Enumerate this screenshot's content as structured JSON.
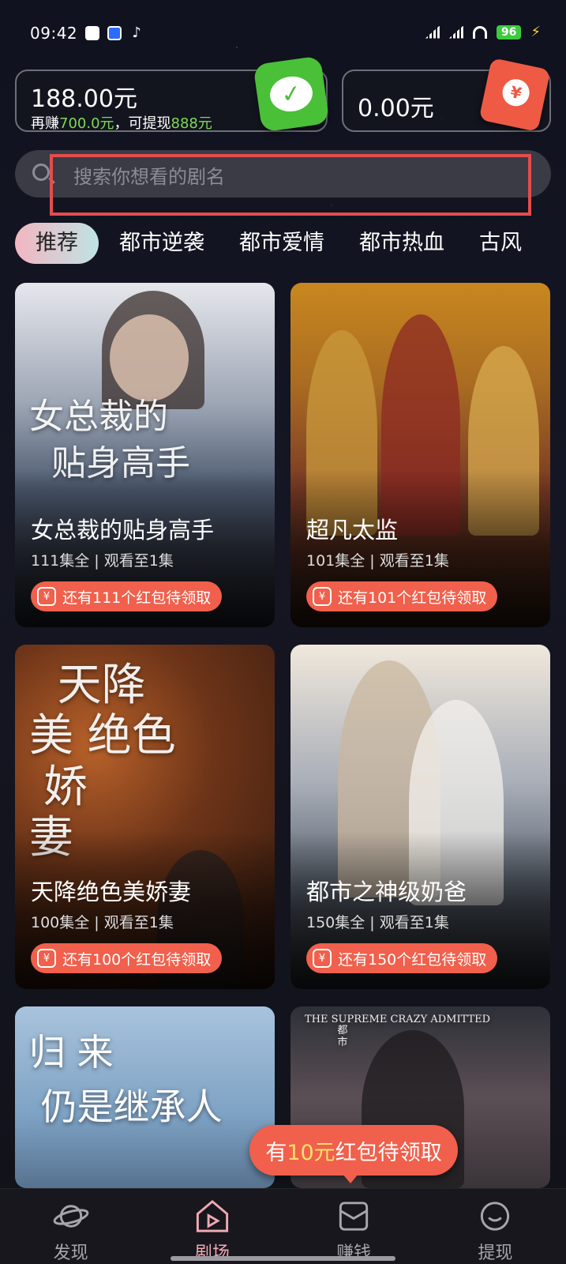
{
  "status_bar": {
    "time": "09:42",
    "battery": "96"
  },
  "wallet": {
    "amount": "188.00元",
    "sub_prefix": "再赚",
    "sub_earn": "700.0元",
    "sub_mid": "，可提现",
    "sub_withdraw": "888元",
    "badge_icon": "wechat-pay-icon"
  },
  "red_wallet": {
    "amount": "0.00元",
    "badge_icon": "red-envelope-icon",
    "coin_symbol": "¥"
  },
  "search": {
    "placeholder": "搜索你想看的剧名"
  },
  "tabs": [
    {
      "label": "推荐",
      "active": true
    },
    {
      "label": "都市逆袭",
      "active": false
    },
    {
      "label": "都市爱情",
      "active": false
    },
    {
      "label": "都市热血",
      "active": false
    },
    {
      "label": "古风",
      "active": false
    }
  ],
  "dramas": [
    {
      "title": "女总裁的贴身高手",
      "poster_text": "女总裁的\n  贴身高手",
      "meta": "111集全 | 观看至1集",
      "reward": "还有111个红包待领取"
    },
    {
      "title": "超凡太监",
      "poster_text": "",
      "meta": "101集全 | 观看至1集",
      "reward": "还有101个红包待领取"
    },
    {
      "title": "天降绝色美娇妻",
      "poster_text": "  天降\n美 绝色\n 娇\n妻",
      "meta": "100集全 | 观看至1集",
      "reward": "还有100个红包待领取"
    },
    {
      "title": "都市之神级奶爸",
      "poster_text": "",
      "meta": "150集全 | 观看至1集",
      "reward": "还有150个红包待领取"
    },
    {
      "title": "",
      "poster_text": "归 来\n 仍是继承人",
      "meta": "",
      "reward": ""
    },
    {
      "title": "",
      "poster_text": "THE SUPREME CRAZY ADMITTED\n          都\n          市",
      "meta": "",
      "reward": ""
    }
  ],
  "float_reward": {
    "prefix": "有",
    "amount": "10元",
    "suffix": "红包待领取"
  },
  "bottom_nav": [
    {
      "label": "发现",
      "icon": "planet-icon",
      "active": false
    },
    {
      "label": "剧场",
      "icon": "theater-icon",
      "active": true
    },
    {
      "label": "赚钱",
      "icon": "envelope-icon",
      "active": false
    },
    {
      "label": "提现",
      "icon": "smile-coin-icon",
      "active": false
    }
  ],
  "colors": {
    "accent_red": "#f0604c",
    "accent_green": "#7ed957",
    "tab_active_gradient_start": "#f2b6c1",
    "tab_active_gradient_end": "#bfe3e4",
    "highlight_box": "#e34d4d"
  }
}
